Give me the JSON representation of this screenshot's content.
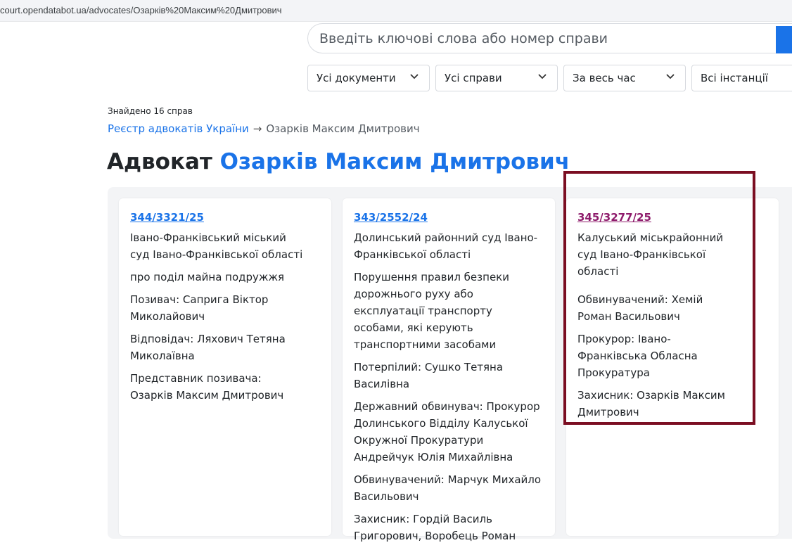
{
  "browser": {
    "url": "court.opendatabot.ua/advocates/Озарків%20Максим%20Дмитрович"
  },
  "search": {
    "placeholder": "Введіть ключові слова або номер справи"
  },
  "filters": [
    {
      "label": "Усі документи"
    },
    {
      "label": "Усі справи"
    },
    {
      "label": "За весь час"
    },
    {
      "label": "Всі інстанції"
    }
  ],
  "results_count": "Знайдено 16 справ",
  "breadcrumb": {
    "parent": "Реєстр адвокатів України",
    "arrow": "→",
    "current": "Озарків Максим Дмитрович"
  },
  "heading": {
    "prefix": "Адвокат",
    "name": "Озарків Максим Дмитрович"
  },
  "cases": [
    {
      "number": "344/3321/25",
      "lines": [
        "Івано-Франківський міський суд Івано-Франківської області",
        "про поділ майна подружжя",
        "Позивач: Саприга Віктор Миколайович",
        "Відповідач: Ляхович Тетяна Миколаївна",
        "Представник позивача: Озарків Максим Дмитрович"
      ]
    },
    {
      "number": "343/2552/24",
      "lines": [
        "Долинський районний суд Івано-Франківської області",
        "Порушення правил безпеки дорожнього руху або експлуатації транспорту особами, які керують транспортними засобами",
        "Потерпілий: Сушко Тетяна Василівна",
        "Державний обвинувач: Прокурор Долинського Відділу Калуської Окружної Прокуратури Андрейчук Юлія Михайлівна",
        "Обвинувачений: Марчук Михайло Васильович",
        "Захисник: Гордій Василь Григорович, Воробець Роман"
      ]
    },
    {
      "number": "345/3277/25",
      "lines": [
        "Калуський міськрайонний суд Івано-Франківської області",
        "Обвинувачений: Хемій Роман Васильович",
        "Прокурор: Івано-Франківська Обласна Прокуратура",
        "Захисник: Озарків Максим Дмитрович"
      ]
    }
  ],
  "colors": {
    "accent": "#1a73e8",
    "visited": "#8e1b6b",
    "highlight": "#7b0e22"
  }
}
